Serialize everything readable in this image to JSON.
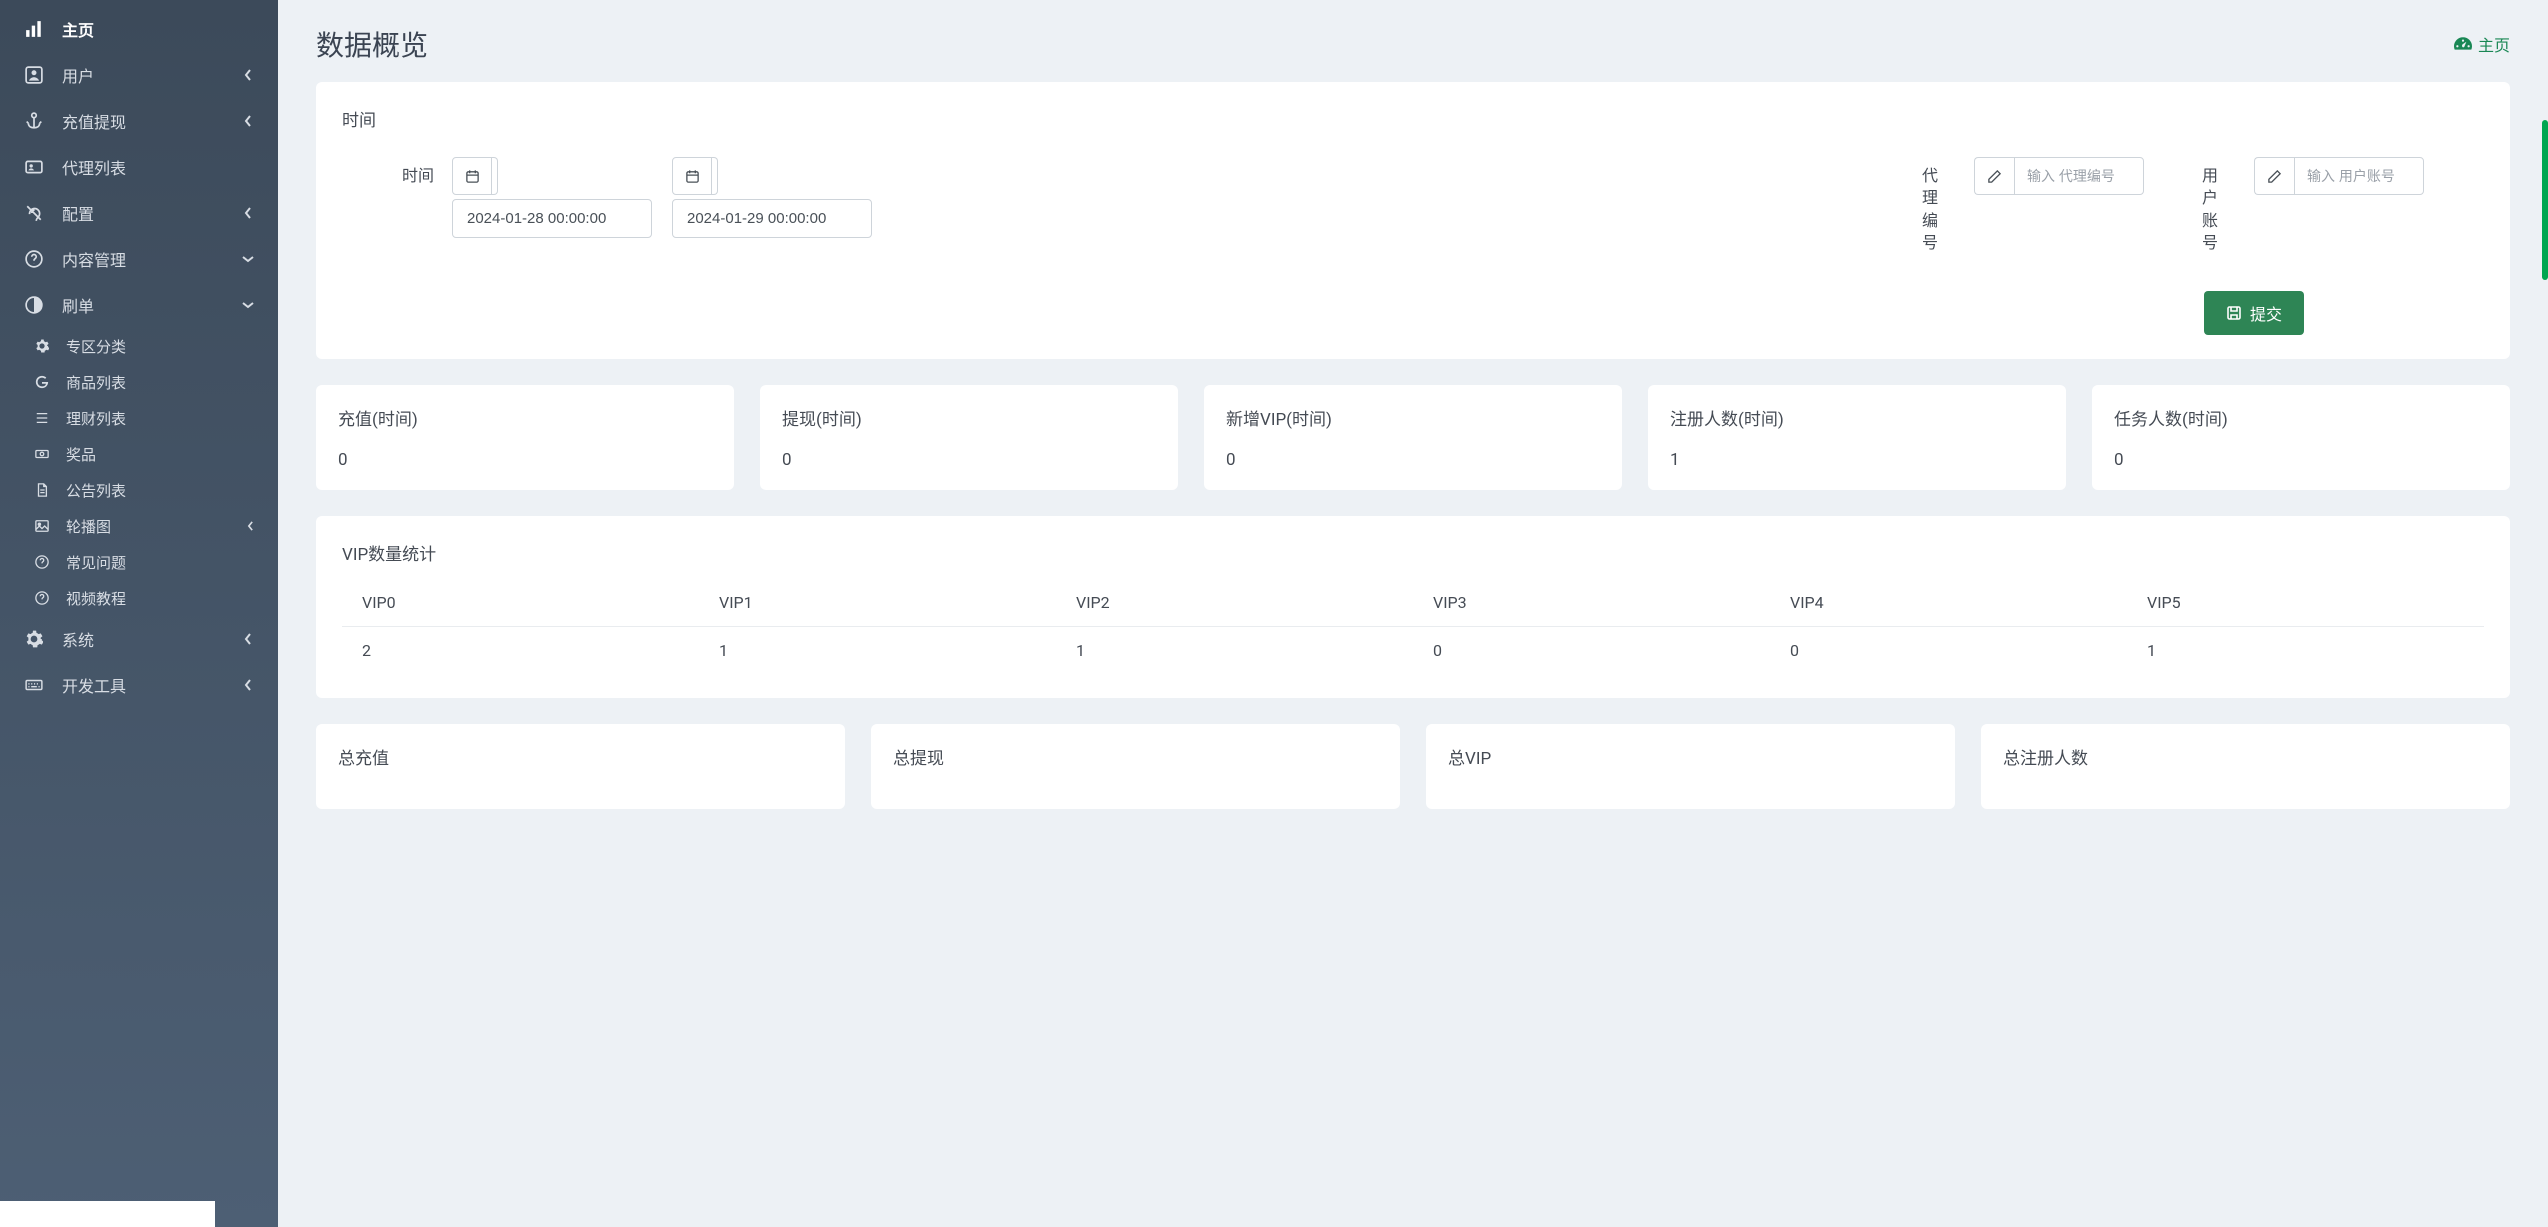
{
  "sidebar": {
    "items": [
      {
        "label": "主页",
        "icon": "chart"
      },
      {
        "label": "用户",
        "icon": "user-box",
        "chev": "left"
      },
      {
        "label": "充值提现",
        "icon": "anchor",
        "chev": "left"
      },
      {
        "label": "代理列表",
        "icon": "id-card"
      },
      {
        "label": "配置",
        "icon": "deaf",
        "chev": "left"
      },
      {
        "label": "内容管理",
        "icon": "question",
        "chev": "down"
      },
      {
        "label": "刷单",
        "icon": "contrast",
        "chev": "down"
      }
    ],
    "sub_shuadan": [
      {
        "label": "专区分类",
        "icon": "gear-small"
      },
      {
        "label": "商品列表",
        "icon": "g"
      }
    ],
    "sub_content": [
      {
        "label": "理财列表",
        "icon": "list"
      },
      {
        "label": "奖品",
        "icon": "money"
      },
      {
        "label": "公告列表",
        "icon": "doc"
      },
      {
        "label": "轮播图",
        "icon": "image",
        "chev": "left"
      },
      {
        "label": "常见问题",
        "icon": "question"
      },
      {
        "label": "视频教程",
        "icon": "question"
      }
    ],
    "tail": [
      {
        "label": "系统",
        "icon": "gear",
        "chev": "left"
      },
      {
        "label": "开发工具",
        "icon": "keyboard",
        "chev": "left"
      }
    ]
  },
  "page": {
    "title": "数据概览"
  },
  "breadcrumb": {
    "label": "主页"
  },
  "filter": {
    "card_title": "时间",
    "time_label": "时间",
    "from": "2024-01-28 00:00:00",
    "to": "2024-01-29 00:00:00",
    "agent_id_label": "代\n理\n编\n号",
    "agent_id_placeholder": "输入 代理编号",
    "user_acct_label": "用\n户\n账\n号",
    "user_acct_placeholder": "输入 用户账号",
    "submit_label": "提交"
  },
  "stats": [
    {
      "title": "充值(时间)",
      "value": "0"
    },
    {
      "title": "提现(时间)",
      "value": "0"
    },
    {
      "title": "新增VIP(时间)",
      "value": "0"
    },
    {
      "title": "注册人数(时间)",
      "value": "1"
    },
    {
      "title": "任务人数(时间)",
      "value": "0"
    }
  ],
  "vip": {
    "title": "VIP数量统计",
    "headers": [
      "VIP0",
      "VIP1",
      "VIP2",
      "VIP3",
      "VIP4",
      "VIP5"
    ],
    "values": [
      "2",
      "1",
      "1",
      "0",
      "0",
      "1"
    ]
  },
  "totals": [
    {
      "title": "总充值"
    },
    {
      "title": "总提现"
    },
    {
      "title": "总VIP"
    },
    {
      "title": "总注册人数"
    }
  ],
  "colors": {
    "accent": "#2e8555",
    "breadcrumb": "#198754"
  }
}
